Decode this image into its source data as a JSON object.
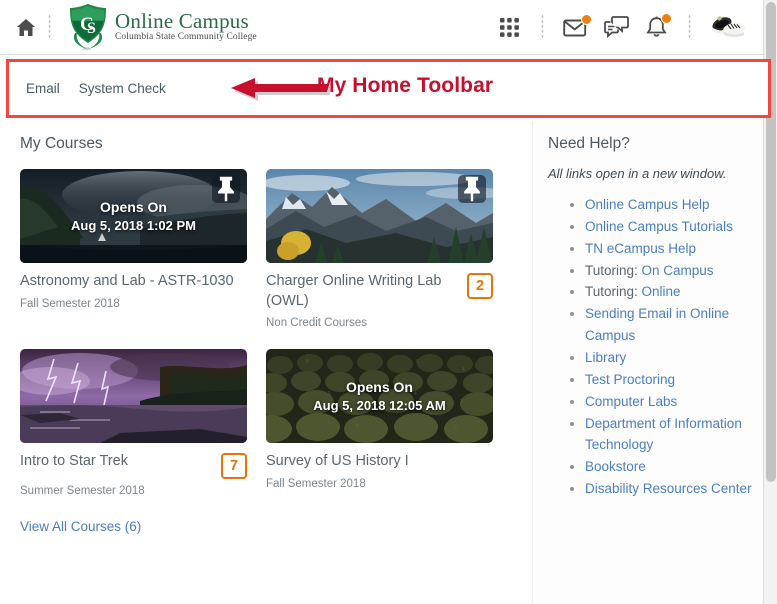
{
  "header": {
    "home_icon": "home-icon",
    "brand_title": "Online Campus",
    "brand_subtitle": "Columbia State Community College",
    "logo_alt": "columbia-state-shield-logo",
    "icons": [
      {
        "name": "waffle-grid-icon",
        "badge": false
      },
      {
        "name": "envelope-icon",
        "badge": true
      },
      {
        "name": "chat-bubbles-icon",
        "badge": false
      },
      {
        "name": "bell-icon",
        "badge": true
      }
    ],
    "avatar_alt": "user-profile-sneakers-photo",
    "badge_color": "#f07f13"
  },
  "toolbar": {
    "links": [
      "Email",
      "System Check"
    ],
    "annotation_text": "My Home Toolbar",
    "annotation_color": "#c8102e",
    "highlight_color": "#f4463f"
  },
  "main": {
    "section_title": "My Courses",
    "view_all_label": "View All Courses (6)",
    "courses": [
      {
        "title": "Astronomy and Lab - ASTR-1030",
        "subtitle": "Fall Semester 2018",
        "overlay_label": "Opens On",
        "overlay_date": "Aug 5, 2018 1:02 PM",
        "badge": null,
        "pinned": true,
        "image_alt": "dark-coastal-cliffs-photo"
      },
      {
        "title": "Charger Online Writing Lab (OWL)",
        "subtitle": "Non Credit Courses",
        "overlay_label": null,
        "overlay_date": null,
        "badge": "2",
        "pinned": true,
        "image_alt": "mountain-autumn-landscape-photo"
      },
      {
        "title": "Intro to Star Trek",
        "subtitle": "Summer Semester 2018",
        "overlay_label": null,
        "overlay_date": null,
        "badge": "7",
        "pinned": false,
        "image_alt": "purple-lightning-storm-photo"
      },
      {
        "title": "Survey of US History I",
        "subtitle": "Fall Semester 2018",
        "overlay_label": "Opens On",
        "overlay_date": "Aug 5, 2018 12:05 AM",
        "badge": null,
        "pinned": false,
        "image_alt": "auditorium-seats-photo"
      }
    ],
    "badge_color": "#e8730c"
  },
  "sidebar": {
    "title": "Need Help?",
    "note": "All links open in a new window.",
    "link_color": "#4a7fc1",
    "items": [
      {
        "prefix": "",
        "link": "Online Campus Help"
      },
      {
        "prefix": "",
        "link": "Online Campus Tutorials"
      },
      {
        "prefix": "",
        "link": "TN eCampus Help"
      },
      {
        "prefix": "Tutoring: ",
        "link": "On Campus"
      },
      {
        "prefix": "Tutoring: ",
        "link": "Online"
      },
      {
        "prefix": "",
        "link": "Sending Email in Online Campus"
      },
      {
        "prefix": "",
        "link": "Library"
      },
      {
        "prefix": "",
        "link": "Test Proctoring"
      },
      {
        "prefix": "",
        "link": "Computer Labs"
      },
      {
        "prefix": "",
        "link": "Department of Information Technology"
      },
      {
        "prefix": "",
        "link": "Bookstore"
      },
      {
        "prefix": "",
        "link": "Disability Resources Center"
      }
    ]
  }
}
